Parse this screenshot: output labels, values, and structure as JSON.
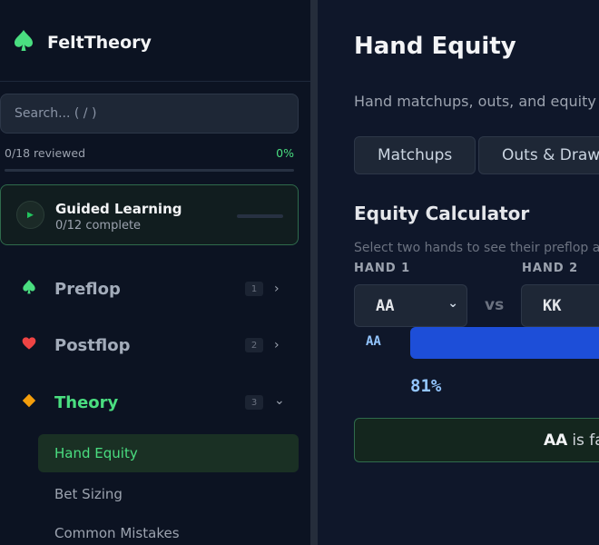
{
  "app": {
    "title": "FeltTheory"
  },
  "sidebar": {
    "search_placeholder": "Search... ( / )",
    "review": {
      "count_text": "0/18 reviewed",
      "percent_text": "0%",
      "progress": 0
    },
    "guided": {
      "title": "Guided Learning",
      "subtitle": "0/12 complete",
      "progress": 0
    },
    "nav": [
      {
        "label": "Preflop",
        "badge": "1",
        "icon": "spade-icon",
        "color": "#4ade80",
        "chevron": "›"
      },
      {
        "label": "Postflop",
        "badge": "2",
        "icon": "heart-icon",
        "color": "#ef4444",
        "chevron": "›"
      },
      {
        "label": "Theory",
        "badge": "3",
        "icon": "diamond-icon",
        "color": "#f59e0b",
        "chevron": "⌄"
      }
    ],
    "subitems": [
      {
        "label": "Hand Equity",
        "active": true
      },
      {
        "label": "Bet Sizing",
        "active": false
      },
      {
        "label": "Common Mistakes",
        "active": false
      }
    ]
  },
  "main": {
    "title": "Hand Equity",
    "description": "Hand matchups, outs, and equity vs",
    "tabs": [
      {
        "label": "Matchups"
      },
      {
        "label": "Outs & Draws"
      }
    ],
    "calculator": {
      "title": "Equity Calculator",
      "description": "Select two hands to see their preflop a",
      "hand1_label": "HAND 1",
      "hand2_label": "HAND 2",
      "hand1_value": "AA",
      "hand2_value": "KK",
      "vs_text": "vs",
      "equity_label": "AA",
      "equity_percent": 81,
      "equity_text": "81%",
      "result_hand": "AA",
      "result_text": "is fa"
    }
  },
  "colors": {
    "accent": "#4ade80",
    "equity_bar": "#1d4ed8",
    "equity_text": "#93c5fd"
  }
}
